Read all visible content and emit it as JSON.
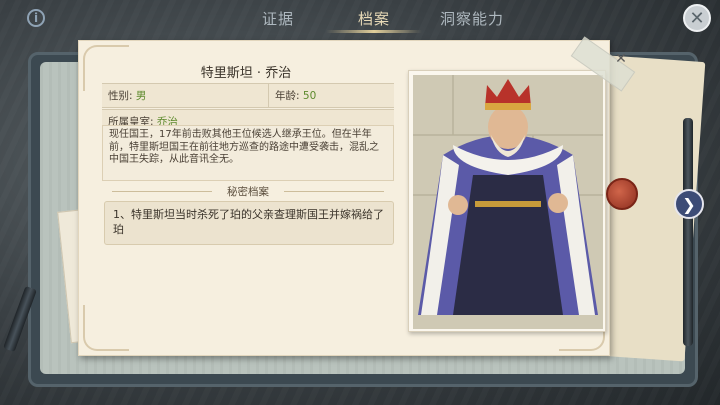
{
  "tabs": [
    {
      "label": "证据",
      "active": false
    },
    {
      "label": "档案",
      "active": true
    },
    {
      "label": "洞察能力",
      "active": false
    }
  ],
  "icons": {
    "info": "i",
    "close": "✕",
    "next": "❯",
    "paper_close": "✕"
  },
  "profile": {
    "name": "特里斯坦 · 乔治",
    "gender_label": "性别:",
    "gender_value": "男",
    "age_label": "年龄:",
    "age_value": "50",
    "house_label": "所属皇室:",
    "house_value": "乔治",
    "description": "现任国王，17年前击败其他王位候选人继承王位。但在半年前，特里斯坦国王在前往地方巡查的路途中遭受袭击，混乱之中国王失踪，从此音讯全无。"
  },
  "secret": {
    "title": "秘密档案",
    "entry": "1、特里斯坦当时杀死了珀的父亲查理斯国王并嫁祸给了珀"
  },
  "colors": {
    "value_green": "#5d8a2d",
    "active_tab": "#e7d9b6",
    "king_robe": "#5b5aa8",
    "crown_red": "#b8322a"
  }
}
